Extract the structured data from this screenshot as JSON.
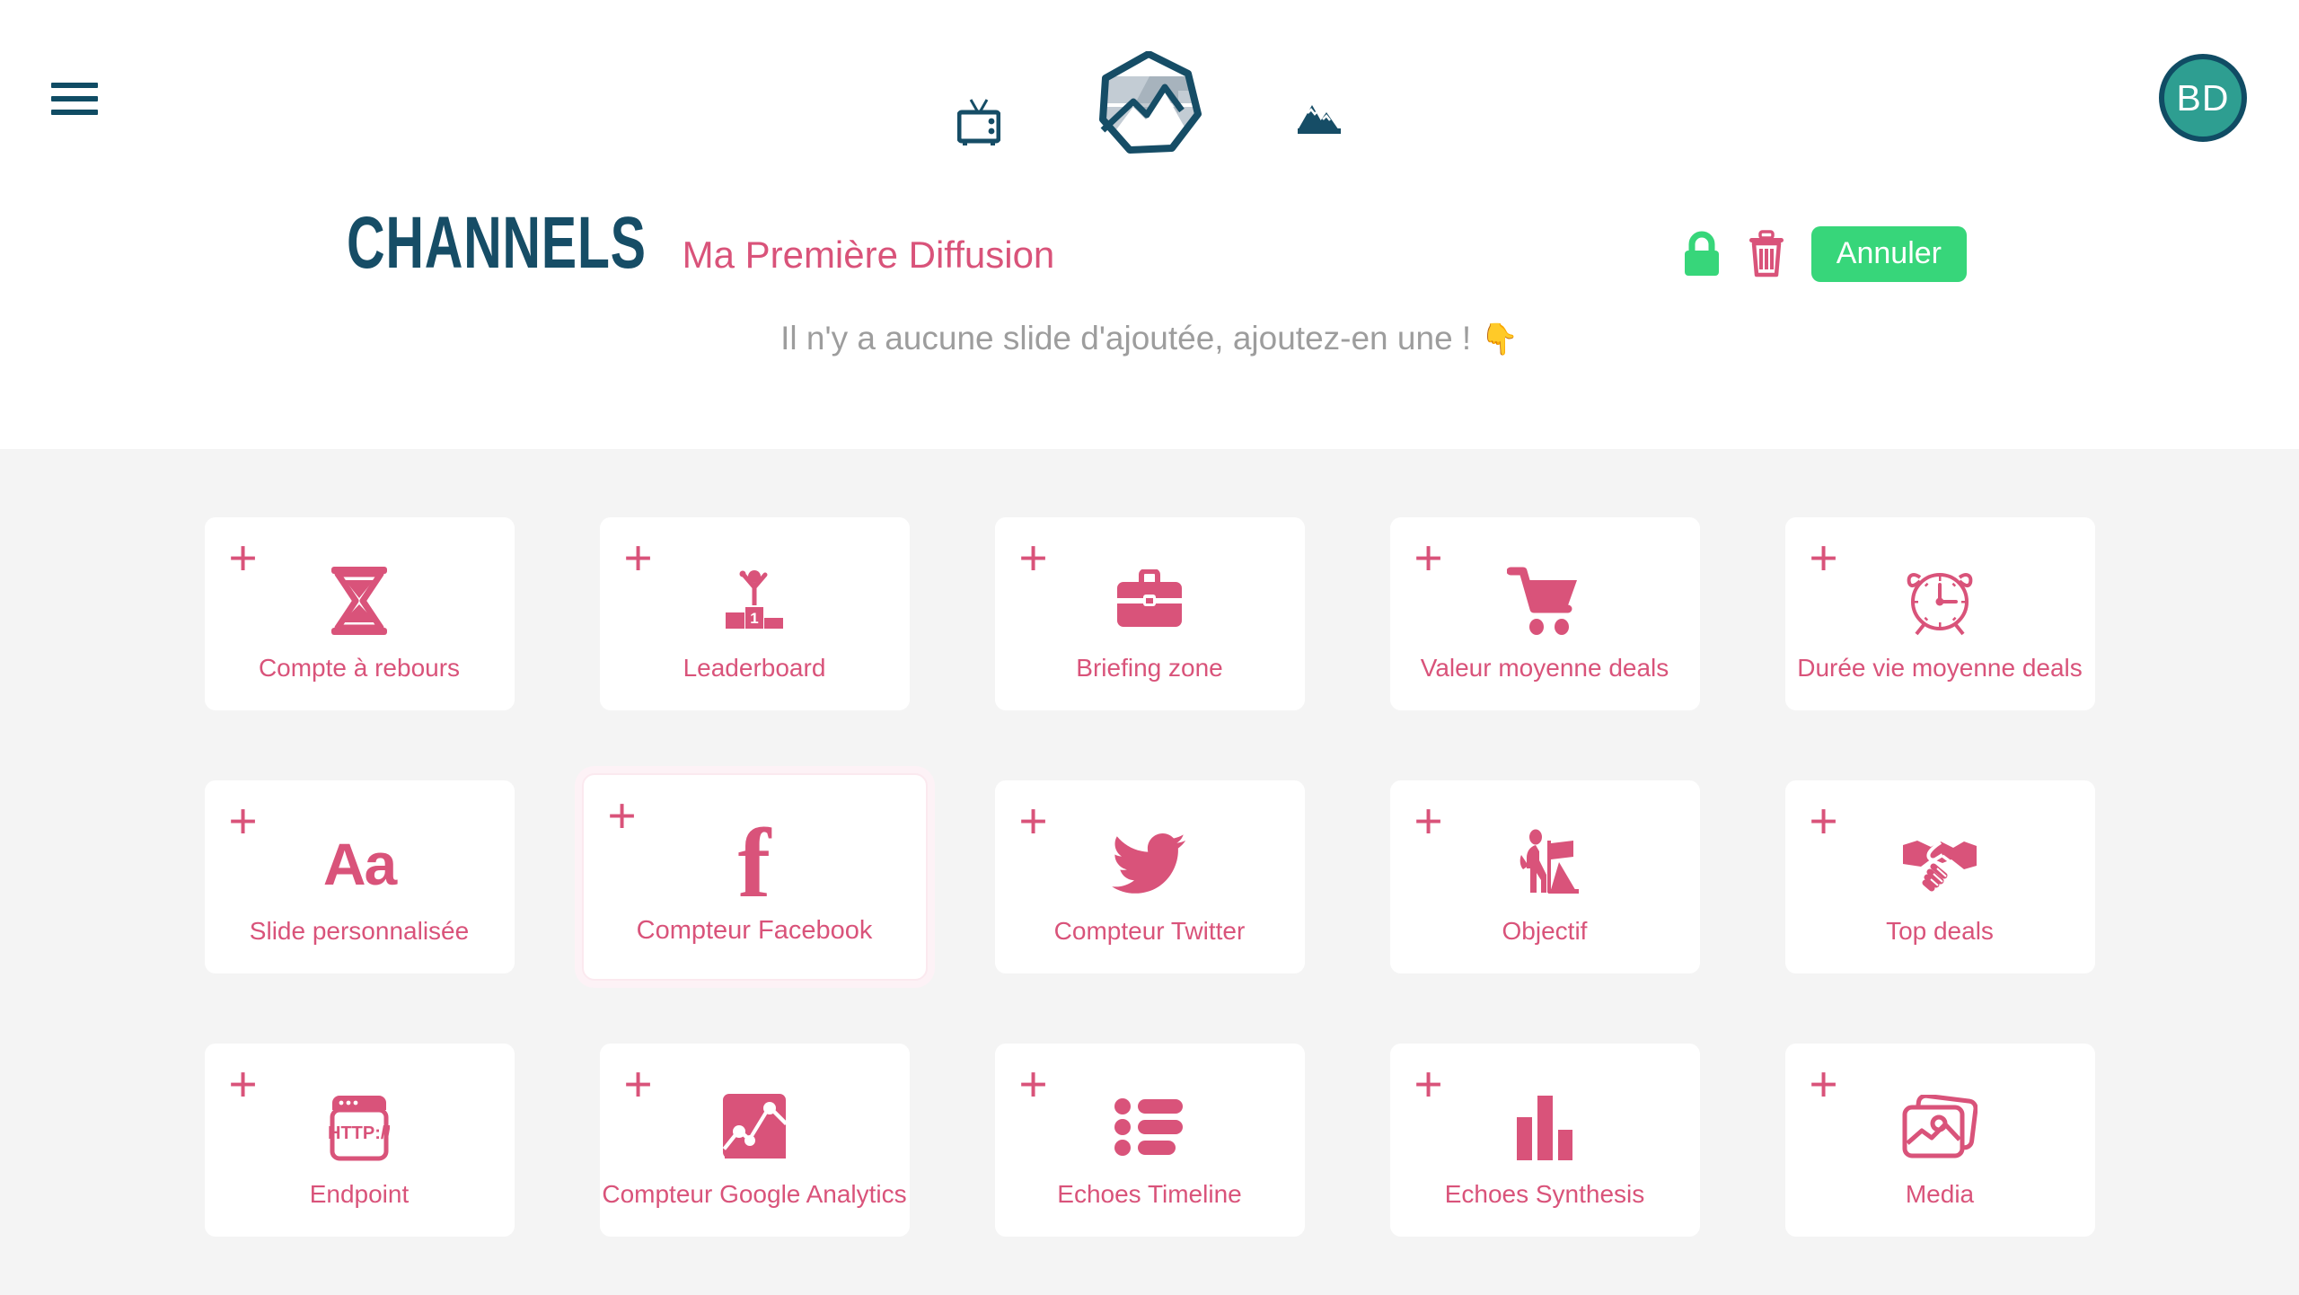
{
  "header": {
    "menu_icon": "hamburger-menu-icon",
    "logo_icon": "mountain-logo-icon",
    "tv_icon": "tv-icon",
    "peak_icon": "mountain-peak-icon",
    "avatar_initials": "BD"
  },
  "title": {
    "main": "CHANNELS",
    "subtitle": "Ma Première Diffusion"
  },
  "actions": {
    "lock_icon": "lock-icon",
    "trash_icon": "trash-icon",
    "cancel_label": "Annuler"
  },
  "empty_state": {
    "message": "Il n'y a aucune slide d'ajoutée, ajoutez-en une !",
    "pointer": "👇"
  },
  "colors": {
    "pink": "#d9537a",
    "dark_blue": "#164d66",
    "green": "#37d67a",
    "teal": "#2e9e91",
    "grid_bg": "#f4f4f4",
    "card_bg": "#ffffff",
    "muted_text": "#9d9d9d"
  },
  "grid": {
    "add_symbol": "+",
    "cards": [
      {
        "label": "Compte à rebours",
        "icon": "hourglass-icon",
        "active": false
      },
      {
        "label": "Leaderboard",
        "icon": "podium-icon",
        "active": false
      },
      {
        "label": "Briefing zone",
        "icon": "briefcase-icon",
        "active": false
      },
      {
        "label": "Valeur moyenne deals",
        "icon": "shopping-cart-icon",
        "active": false
      },
      {
        "label": "Durée vie moyenne deals",
        "icon": "alarm-clock-icon",
        "active": false
      },
      {
        "label": "Slide personnalisée",
        "icon": "text-aa-icon",
        "active": false
      },
      {
        "label": "Compteur Facebook",
        "icon": "facebook-icon",
        "active": true
      },
      {
        "label": "Compteur Twitter",
        "icon": "twitter-icon",
        "active": false
      },
      {
        "label": "Objectif",
        "icon": "hiker-flag-icon",
        "active": false
      },
      {
        "label": "Top deals",
        "icon": "handshake-icon",
        "active": false
      },
      {
        "label": "Endpoint",
        "icon": "http-window-icon",
        "active": false
      },
      {
        "label": "Compteur Google Analytics",
        "icon": "line-chart-icon",
        "active": false
      },
      {
        "label": "Echoes Timeline",
        "icon": "bullet-list-icon",
        "active": false
      },
      {
        "label": "Echoes Synthesis",
        "icon": "bar-chart-icon",
        "active": false
      },
      {
        "label": "Media",
        "icon": "photos-icon",
        "active": false
      }
    ]
  }
}
